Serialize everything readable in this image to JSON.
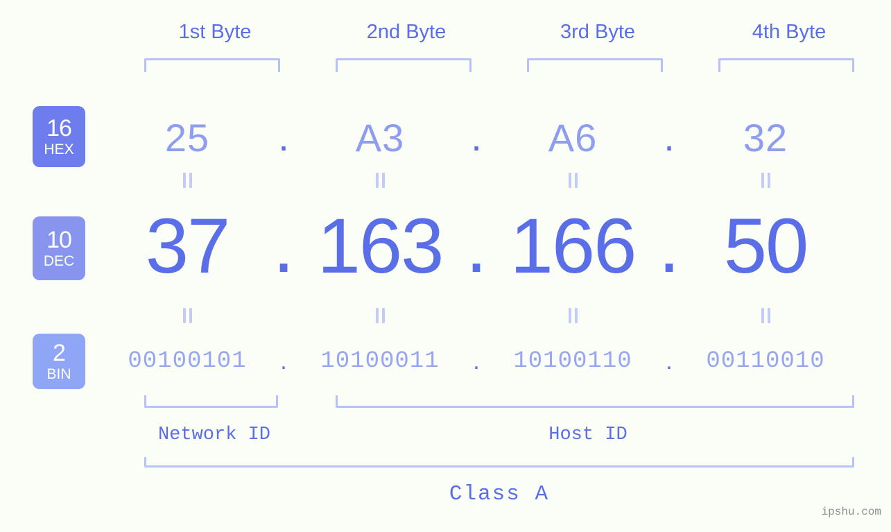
{
  "page": {
    "background_color": "#fbfdf7",
    "watermark": "ipshu.com"
  },
  "colors": {
    "header_text": "#5a6ee8",
    "bracket": "#b9c2f7",
    "hex_text": "#8f9df1",
    "dec_text": "#5a6ee8",
    "bin_text": "#98a6f2",
    "badge_hex": "#6d7ded",
    "badge_dec": "#8795ef",
    "badge_bin": "#8fa5f5",
    "eq_mark": "#c3cbf8",
    "watermark": "#8f8f8f"
  },
  "byte_headers": [
    {
      "label": "1st Byte"
    },
    {
      "label": "2nd Byte"
    },
    {
      "label": "3rd Byte"
    },
    {
      "label": "4th Byte"
    }
  ],
  "bases": [
    {
      "number": "16",
      "name": "HEX"
    },
    {
      "number": "10",
      "name": "DEC"
    },
    {
      "number": "2",
      "name": "BIN"
    }
  ],
  "separator": ".",
  "rows": {
    "hex": {
      "base": "16",
      "name": "HEX",
      "octets": [
        "25",
        "A3",
        "A6",
        "32"
      ]
    },
    "dec": {
      "base": "10",
      "name": "DEC",
      "octets": [
        "37",
        "163",
        "166",
        "50"
      ]
    },
    "bin": {
      "base": "2",
      "name": "BIN",
      "octets": [
        "00100101",
        "10100011",
        "10100110",
        "00110010"
      ]
    }
  },
  "ip_address": "37.163.166.50",
  "segments": {
    "network_id": {
      "label": "Network ID",
      "bytes": [
        1
      ]
    },
    "host_id": {
      "label": "Host ID",
      "bytes": [
        2,
        3,
        4
      ]
    }
  },
  "class": {
    "label": "Class A"
  }
}
